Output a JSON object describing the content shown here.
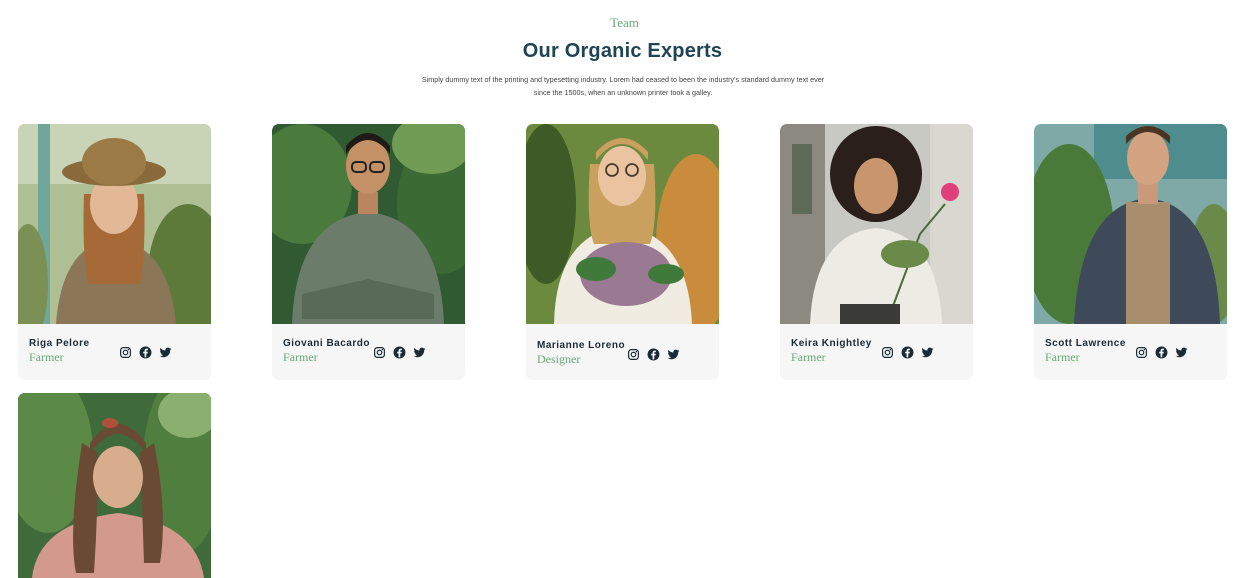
{
  "header": {
    "eyebrow": "Team",
    "title": "Our Organic Experts",
    "description": "Simply dummy text of the printing and typesetting industry. Lorem had ceased to been the industry's standard dummy text ever since the 1500s, when an unknown printer took a galley."
  },
  "members": [
    {
      "name": "Riga Pelore",
      "role": "Farmer"
    },
    {
      "name": "Giovani Bacardo",
      "role": "Farmer"
    },
    {
      "name": "Marianne Loreno",
      "role": "Designer"
    },
    {
      "name": "Keira Knightley",
      "role": "Farmer"
    },
    {
      "name": "Scott Lawrence",
      "role": "Farmer"
    }
  ],
  "social_icons": [
    "instagram-icon",
    "facebook-icon",
    "twitter-icon"
  ],
  "colors": {
    "accent_green": "#6aa87a",
    "heading": "#1f4453",
    "card_background": "#f6f6f6"
  }
}
